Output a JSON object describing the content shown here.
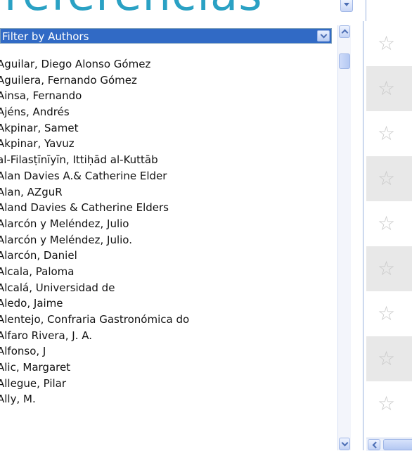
{
  "heading": {
    "text": "referencias"
  },
  "filter": {
    "selected": "Filter by Authors",
    "options": [
      "Aguilar, Diego Alonso Gómez",
      "Aguilera, Fernando Gómez",
      "Ainsa, Fernando",
      "Ajéns, Andrés",
      "Akpinar, Samet",
      "Akpinar, Yavuz",
      "al-Filasṭīnīyīn, Ittiḥād al-Kuttāb",
      "Alan Davies A.& Catherine Elder",
      "Alan, AZguR",
      "Aland Davies & Catherine Elders",
      "Alarcón y Meléndez, Julio",
      "Alarcón y Meléndez, Julio.",
      "Alarcón, Daniel",
      "Alcala, Paloma",
      "Alcalá, Universidad de",
      "Aledo, Jaime",
      "Alentejo, Confraria Gastronómica do",
      "Alfaro Rivera, J. A.",
      "Alfonso, J",
      "Alic, Margaret",
      "Allegue, Pilar",
      "Ally, M."
    ]
  },
  "stars": {
    "icon": "star-outline-icon",
    "count": 9,
    "symbol": "☆"
  }
}
